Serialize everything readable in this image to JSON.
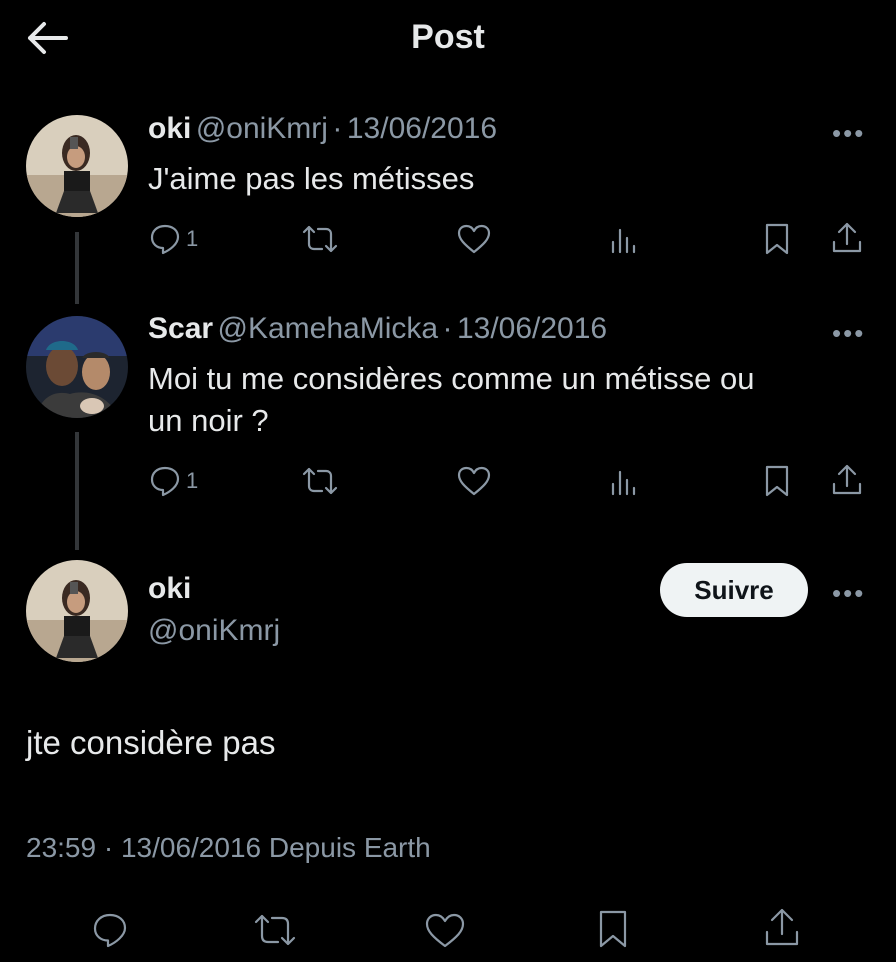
{
  "header": {
    "title": "Post",
    "back_icon": "arrow-left-icon"
  },
  "tweets": [
    {
      "name": "oki",
      "handle": "@oniKmrj",
      "sep": "·",
      "date": "13/06/2016",
      "text": "J'aime pas les métisses",
      "reply_count": "1"
    },
    {
      "name": "Scar",
      "handle": "@KamehaMicka",
      "sep": "·",
      "date": "13/06/2016",
      "text_line1": "Moi tu me considères comme un métisse ou",
      "text_line2": "un noir ?",
      "reply_count": "1"
    }
  ],
  "main": {
    "name": "oki",
    "handle": "@oniKmrj",
    "follow_label": "Suivre",
    "text": "jte considère pas",
    "timestamp": "23:59 · 13/06/2016",
    "source": "Depuis Earth"
  },
  "colors": {
    "background": "#000000",
    "text": "#e7e9ea",
    "muted": "#8b98a5",
    "line": "#333639"
  }
}
